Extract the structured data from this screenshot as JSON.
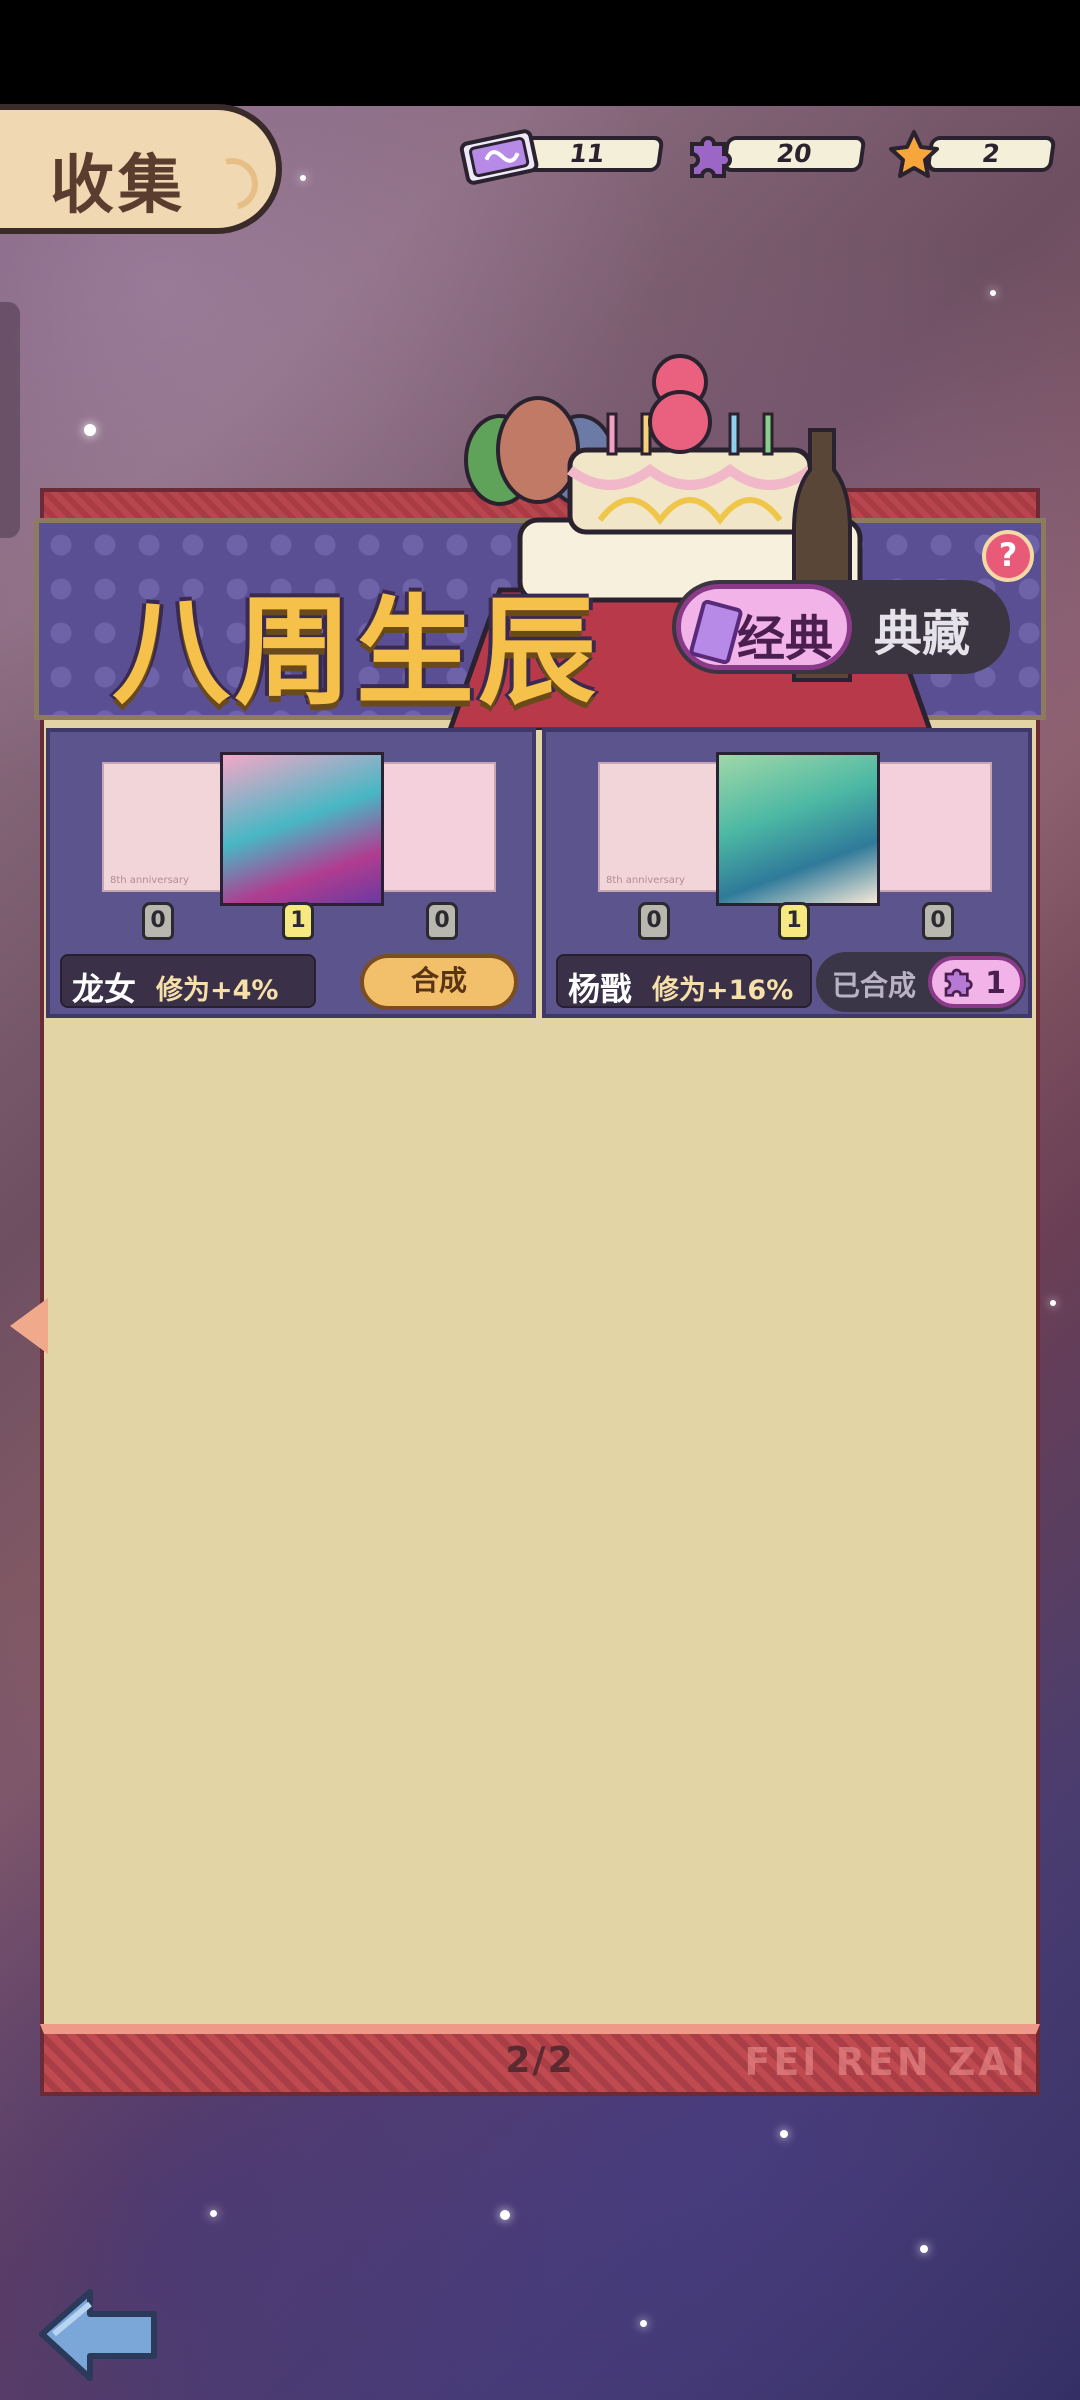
{
  "header": {
    "title": "收集"
  },
  "resources": [
    {
      "icon": "ticket-icon",
      "value": "11",
      "color": "#b68ae6"
    },
    {
      "icon": "puzzle-piece-icon",
      "value": "20",
      "color": "#9b66c6"
    },
    {
      "icon": "star-icon",
      "value": "2",
      "color": "#f6a63a"
    }
  ],
  "event": {
    "title": "八周生辰",
    "tabs": {
      "classic": "经典",
      "collection": "典藏"
    },
    "help": "?"
  },
  "cards": [
    {
      "name": "龙女",
      "bonus": "修为+4%",
      "art_caption": "8th anniversary",
      "pieces": [
        {
          "value": "0",
          "owned": false
        },
        {
          "value": "1",
          "owned": true
        },
        {
          "value": "0",
          "owned": false
        }
      ],
      "action": {
        "label": "合成",
        "state": "available"
      }
    },
    {
      "name": "杨戬",
      "bonus": "修为+16%",
      "art_caption": "8th anniversary",
      "pieces": [
        {
          "value": "0",
          "owned": false
        },
        {
          "value": "1",
          "owned": true
        },
        {
          "value": "0",
          "owned": false
        }
      ],
      "action": {
        "label": "已合成",
        "state": "done",
        "count": "1"
      }
    }
  ],
  "pagination": {
    "label": "2/2"
  },
  "watermark": "FEI REN ZAI"
}
